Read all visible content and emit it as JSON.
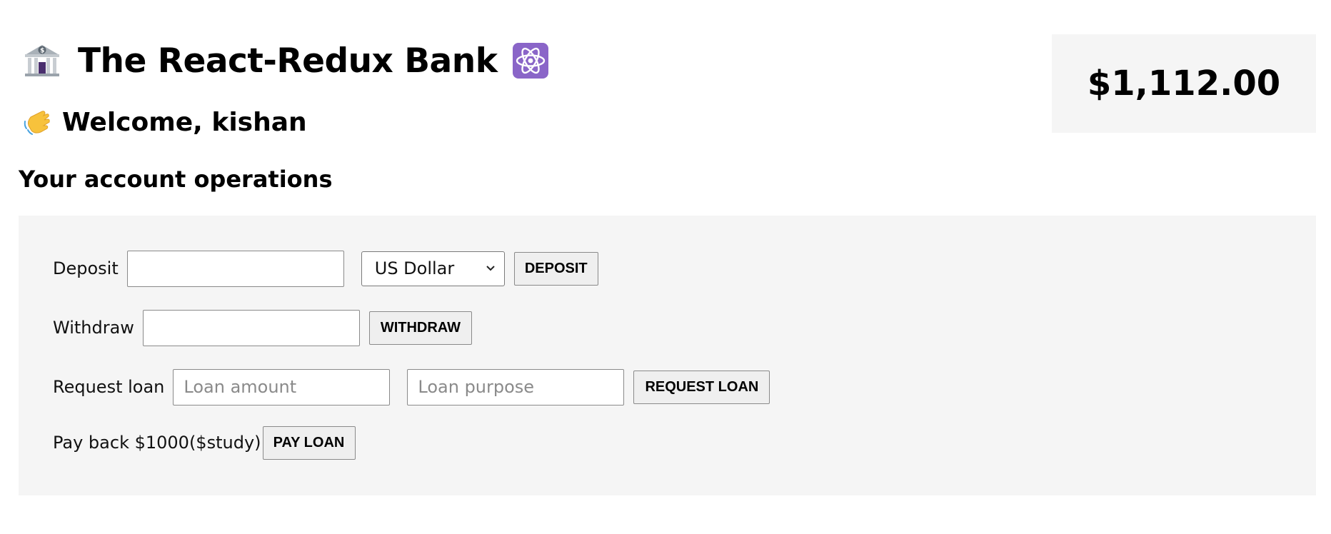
{
  "header": {
    "title": "The React-Redux Bank",
    "bank_icon": "bank-icon",
    "react_icon": "react-atom-icon",
    "welcome": "Welcome, kishan",
    "wave_icon": "waving-hand-icon"
  },
  "balance": {
    "amount": "$1,112.00"
  },
  "operations": {
    "title": "Your account operations",
    "deposit": {
      "label": "Deposit",
      "value": "",
      "currency_selected": "US Dollar",
      "button": "DEPOSIT"
    },
    "withdraw": {
      "label": "Withdraw",
      "value": "",
      "button": "WITHDRAW"
    },
    "loan": {
      "label": "Request loan",
      "amount_placeholder": "Loan amount",
      "purpose_placeholder": "Loan purpose",
      "button": "REQUEST LOAN"
    },
    "payback": {
      "label": "Pay back $1000($study)",
      "button": "PAY LOAN"
    }
  },
  "colors": {
    "panel_bg": "#f5f5f5",
    "react_tile": "#8a65c8",
    "button_bg": "#efefef"
  }
}
